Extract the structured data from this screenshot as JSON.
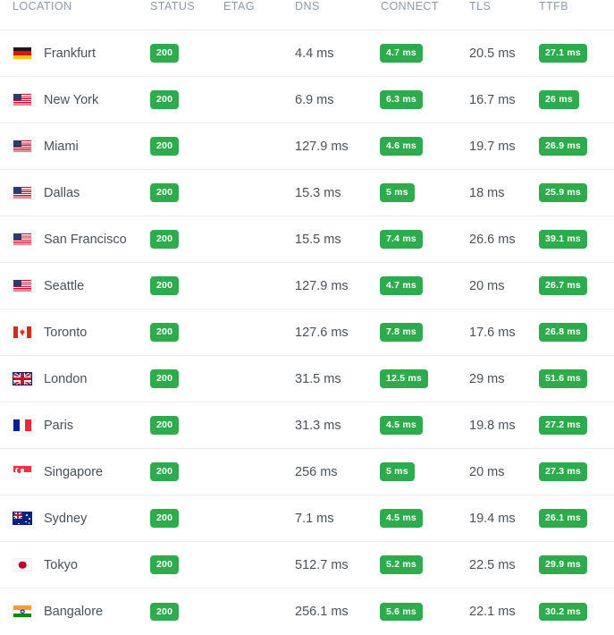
{
  "table": {
    "columns": [
      {
        "key": "location",
        "label": "LOCATION"
      },
      {
        "key": "status",
        "label": "STATUS"
      },
      {
        "key": "etag",
        "label": "ETAG"
      },
      {
        "key": "dns",
        "label": "DNS"
      },
      {
        "key": "connect",
        "label": "CONNECT"
      },
      {
        "key": "tls",
        "label": "TLS"
      },
      {
        "key": "ttfb",
        "label": "TTFB"
      }
    ],
    "badge_color": "#2eac4d",
    "badge_text_color": "#ffffff",
    "header_text_color": "#8e99a8",
    "body_text_color": "#4a5159",
    "row_divider_color": "#ebedf0",
    "rows": [
      {
        "flag": "flag-de",
        "flag_name": "flag-germany",
        "location": "Frankfurt",
        "status": "200",
        "etag": "",
        "dns": "4.4 ms",
        "connect": "4.7 ms",
        "tls": "20.5 ms",
        "ttfb": "27.1 ms"
      },
      {
        "flag": "flag-us",
        "flag_name": "flag-united-states",
        "location": "New York",
        "status": "200",
        "etag": "",
        "dns": "6.9 ms",
        "connect": "6.3 ms",
        "tls": "16.7 ms",
        "ttfb": "26 ms"
      },
      {
        "flag": "flag-us",
        "flag_name": "flag-united-states",
        "location": "Miami",
        "status": "200",
        "etag": "",
        "dns": "127.9 ms",
        "connect": "4.6 ms",
        "tls": "19.7 ms",
        "ttfb": "26.9 ms"
      },
      {
        "flag": "flag-us",
        "flag_name": "flag-united-states",
        "location": "Dallas",
        "status": "200",
        "etag": "",
        "dns": "15.3 ms",
        "connect": "5 ms",
        "tls": "18 ms",
        "ttfb": "25.9 ms"
      },
      {
        "flag": "flag-us",
        "flag_name": "flag-united-states",
        "location": "San Francisco",
        "status": "200",
        "etag": "",
        "dns": "15.5 ms",
        "connect": "7.4 ms",
        "tls": "26.6 ms",
        "ttfb": "39.1 ms"
      },
      {
        "flag": "flag-us",
        "flag_name": "flag-united-states",
        "location": "Seattle",
        "status": "200",
        "etag": "",
        "dns": "127.9 ms",
        "connect": "4.7 ms",
        "tls": "20 ms",
        "ttfb": "26.7 ms"
      },
      {
        "flag": "flag-ca",
        "flag_name": "flag-canada",
        "location": "Toronto",
        "status": "200",
        "etag": "",
        "dns": "127.6 ms",
        "connect": "7.8 ms",
        "tls": "17.6 ms",
        "ttfb": "26.8 ms"
      },
      {
        "flag": "flag-gb",
        "flag_name": "flag-united-kingdom",
        "location": "London",
        "status": "200",
        "etag": "",
        "dns": "31.5 ms",
        "connect": "12.5 ms",
        "tls": "29 ms",
        "ttfb": "51.6 ms"
      },
      {
        "flag": "flag-fr",
        "flag_name": "flag-france",
        "location": "Paris",
        "status": "200",
        "etag": "",
        "dns": "31.3 ms",
        "connect": "4.5 ms",
        "tls": "19.8 ms",
        "ttfb": "27.2 ms"
      },
      {
        "flag": "flag-sg",
        "flag_name": "flag-singapore",
        "location": "Singapore",
        "status": "200",
        "etag": "",
        "dns": "256 ms",
        "connect": "5 ms",
        "tls": "20 ms",
        "ttfb": "27.3 ms"
      },
      {
        "flag": "flag-au",
        "flag_name": "flag-australia",
        "location": "Sydney",
        "status": "200",
        "etag": "",
        "dns": "7.1 ms",
        "connect": "4.5 ms",
        "tls": "19.4 ms",
        "ttfb": "26.1 ms"
      },
      {
        "flag": "flag-jp",
        "flag_name": "flag-japan",
        "location": "Tokyo",
        "status": "200",
        "etag": "",
        "dns": "512.7 ms",
        "connect": "5.2 ms",
        "tls": "22.5 ms",
        "ttfb": "29.9 ms"
      },
      {
        "flag": "flag-in",
        "flag_name": "flag-india",
        "location": "Bangalore",
        "status": "200",
        "etag": "",
        "dns": "256.1 ms",
        "connect": "5.6 ms",
        "tls": "22.1 ms",
        "ttfb": "30.2 ms"
      }
    ]
  }
}
